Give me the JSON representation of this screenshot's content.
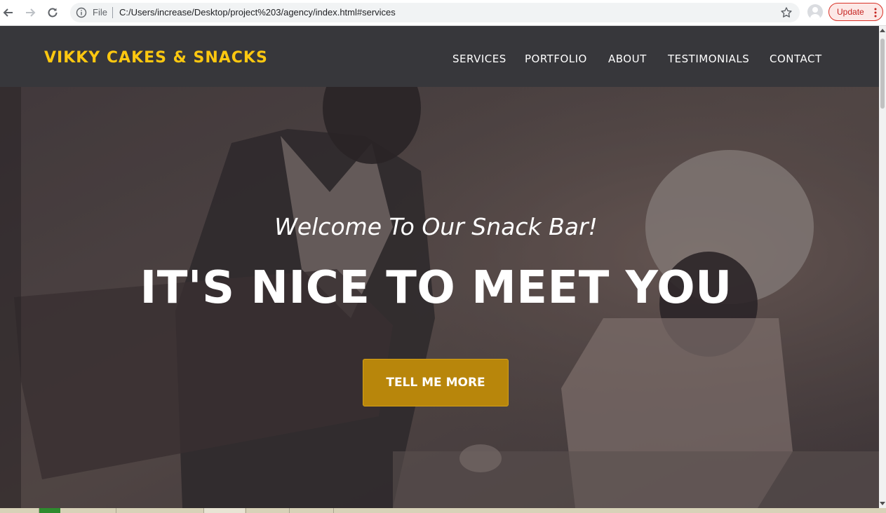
{
  "browser": {
    "back_icon": "arrow-left-icon",
    "forward_icon": "arrow-right-icon",
    "reload_icon": "reload-icon",
    "info_icon": "info-circle-icon",
    "file_label": "File",
    "url": "C:/Users/increase/Desktop/project%203/agency/index.html#services",
    "bookmark_icon": "star-icon",
    "profile_icon": "avatar-icon",
    "update_label": "Update",
    "menu_icon": "kebab-icon",
    "update_color": "#d93025"
  },
  "site": {
    "brand": "VIKKY CAKES & SNACKS",
    "brand_color": "#fec810",
    "nav_background": "#37373b",
    "menu": [
      {
        "label": "SERVICES"
      },
      {
        "label": "PORTFOLIO"
      },
      {
        "label": "ABOUT"
      },
      {
        "label": "TESTIMONIALS"
      },
      {
        "label": "CONTACT"
      }
    ]
  },
  "hero": {
    "subtitle": "Welcome To Our Snack Bar!",
    "title": "IT'S NICE TO MEET YOU",
    "cta_label": "TELL ME MORE",
    "cta_color": "#b8860b"
  }
}
